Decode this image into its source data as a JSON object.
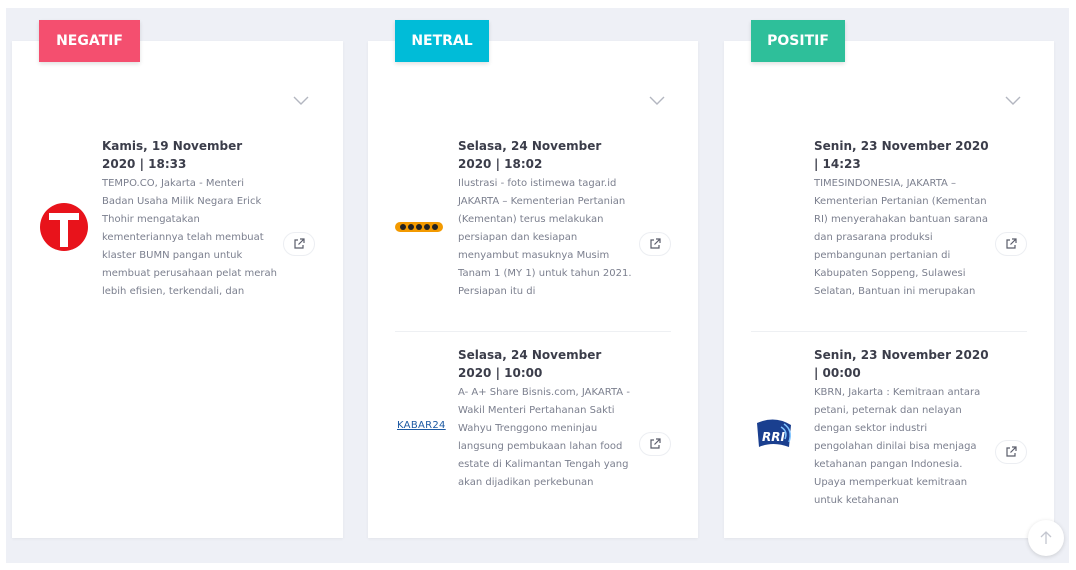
{
  "columns": [
    {
      "key": "negative",
      "label": "NEGATIF",
      "color": "#f44f6f",
      "items": [
        {
          "source_icon": "tempo-logo",
          "title": "Kamis, 19 November 2020 | 18:33",
          "excerpt": "TEMPO.CO, Jakarta - Menteri Badan Usaha Milik Negara Erick Thohir mengatakan kementeriannya telah membuat klaster BUMN pangan untuk membuat perusahaan pelat merah lebih efisien, terkendali, dan"
        }
      ]
    },
    {
      "key": "neutral",
      "label": "NETRAL",
      "color": "#00bcd8",
      "items": [
        {
          "source_icon": "inews-logo",
          "title": "Selasa, 24 November 2020 | 18:02",
          "excerpt": "Ilustrasi - foto istimewa tagar.id JAKARTA – Kementerian Pertanian (Kementan) terus melakukan persiapan dan kesiapan menyambut masuknya Musim Tanam 1 (MY 1) untuk tahun 2021. Persiapan itu di"
        },
        {
          "source_icon": "kabar24-logo",
          "source_text": "KABAR24",
          "title": "Selasa, 24 November 2020 | 10:00",
          "excerpt": "A- A+ Share Bisnis.com, JAKARTA - Wakil Menteri Pertahanan Sakti Wahyu Trenggono meninjau langsung pembukaan lahan food estate di Kalimantan Tengah yang akan dijadikan perkebunan"
        }
      ]
    },
    {
      "key": "positive",
      "label": "POSITIF",
      "color": "#2ebf9a",
      "items": [
        {
          "source_icon": "timesindonesia-logo",
          "title": "Senin, 23 November 2020 | 14:23",
          "excerpt": "TIMESINDONESIA, JAKARTA – Kementerian Pertanian (Kementan RI) menyerahakan bantuan sarana dan prasarana produksi pembangunan pertanian di Kabupaten Soppeng, Sulawesi Selatan, Bantuan ini merupakan"
        },
        {
          "source_icon": "rri-logo",
          "source_text": "RRI",
          "title": "Senin, 23 November 2020 | 00:00",
          "excerpt": "KBRN, Jakarta : Kemitraan antara petani, peternak dan nelayan dengan sektor industri pengolahan dinilai bisa menjaga ketahanan pangan Indonesia.  Upaya memperkuat kemitraan untuk ketahanan"
        }
      ]
    }
  ],
  "icons": {
    "expand": "chevron-down-icon",
    "open_link": "external-link-icon",
    "scroll_top": "arrow-up-icon"
  }
}
